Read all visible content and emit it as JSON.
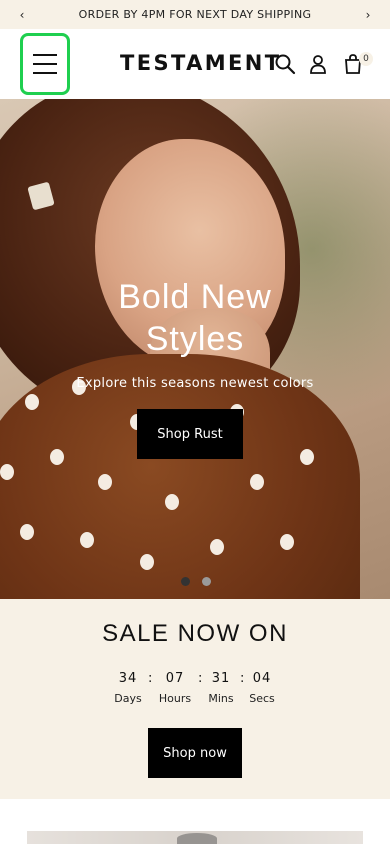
{
  "announcement": {
    "text": "ORDER BY 4PM FOR NEXT DAY SHIPPING",
    "prev": "‹",
    "next": "›"
  },
  "header": {
    "logo": "TESTAMENT",
    "cart_count": "0",
    "icons": [
      "menu-icon",
      "search-icon",
      "account-icon",
      "cart-icon"
    ]
  },
  "hero": {
    "title_line1": "Bold New",
    "title_line2": "Styles",
    "subtitle": "Explore this seasons newest colors",
    "button": "Shop Rust",
    "slides_total": 2,
    "active_slide": 1
  },
  "sale": {
    "title": "SALE NOW ON",
    "countdown": [
      {
        "value": "34",
        "label": "Days"
      },
      {
        "value": "07",
        "label": "Hours"
      },
      {
        "value": "31",
        "label": "Mins"
      },
      {
        "value": "04",
        "label": "Secs"
      }
    ],
    "separator": ":",
    "button": "Shop now"
  },
  "colors": {
    "accent_highlight": "#1fcf4f",
    "cream": "#f7f1e6",
    "button_bg": "#000000"
  }
}
